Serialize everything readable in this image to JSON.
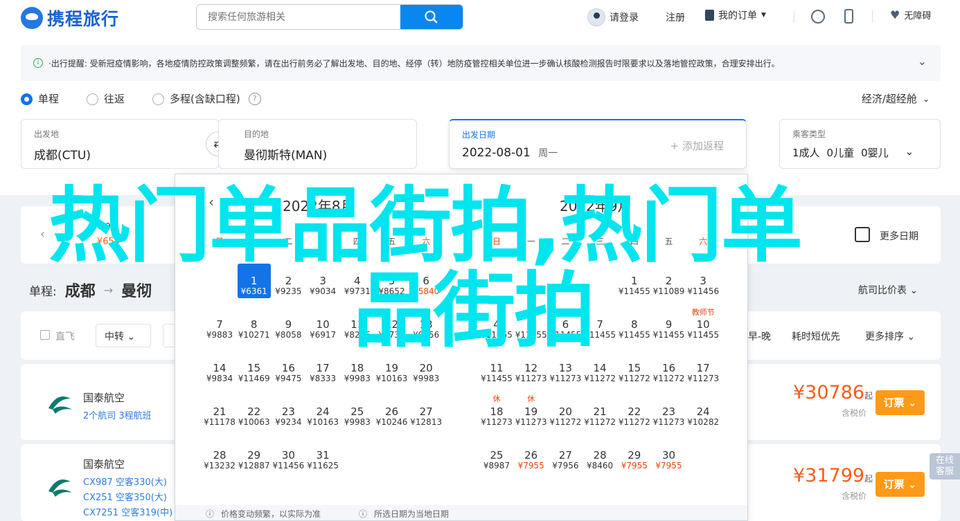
{
  "header": {
    "logo_text": "携程旅行",
    "search_placeholder": "搜索任何旅游相关",
    "login": "请登录",
    "register": "注册",
    "orders": "我的订单",
    "accessible": "无障碍"
  },
  "notice": {
    "text": "·出行提醒: 受新冠疫情影响，各地疫情防控政策调整频繁，请在出行前务必了解出发地、目的地、经停（转）地防疫管控相关单位进一步确认核酸检测报告时限要求以及落地管控政策，合理安排出行。"
  },
  "trip": {
    "oneway": "单程",
    "roundtrip": "往返",
    "multi": "多程(含缺口程)",
    "cabin": "经济/超经舱"
  },
  "form": {
    "from_label": "出发地",
    "from": "成都(CTU)",
    "to_label": "目的地",
    "to": "曼彻斯特(MAN)",
    "date_label": "出发日期",
    "date": "2022-08-01",
    "weekday": "周一",
    "add_return": "+ 添加返程",
    "pax_label": "乘客类型",
    "adult": "1成人",
    "child": "0儿童",
    "infant": "0婴儿"
  },
  "route": {
    "prefix": "单程:",
    "from": "成都",
    "to": "曼彻"
  },
  "strip": {
    "item_date": "7-9",
    "item_price": "¥654",
    "more_dates": "更多日期"
  },
  "sort": {
    "airline_compare": "航司比价表",
    "direct": "直飞",
    "transfer": "中转",
    "early_late": "早-晚",
    "shortest": "耗时短优先",
    "more_sort": "更多排序"
  },
  "flights": [
    {
      "airline": "国泰航空",
      "detail": "2个航司  3程航班",
      "price": "¥30786",
      "qi": "起",
      "tax": "含税价",
      "book": "订票"
    },
    {
      "airline": "国泰航空",
      "lines": [
        "CX987 空客330(大)",
        "CX251 空客350(大)",
        "CX7251 空客319(中)"
      ],
      "price": "¥31799",
      "qi": "起",
      "tax": "含税价",
      "book": "订票"
    }
  ],
  "calendar": {
    "left_title": "2022年8月",
    "right_title": "2022年9月",
    "left_days": [
      {
        "d": "1",
        "p": "¥6361",
        "c": 1,
        "r": 0,
        "sel": true
      },
      {
        "d": "2",
        "p": "¥9235",
        "c": 2,
        "r": 0
      },
      {
        "d": "3",
        "p": "¥9034",
        "c": 3,
        "r": 0
      },
      {
        "d": "4",
        "p": "¥9731",
        "c": 4,
        "r": 0
      },
      {
        "d": "5",
        "p": "¥8652",
        "c": 5,
        "r": 0
      },
      {
        "d": "6",
        "p": "¥5840",
        "c": 6,
        "r": 0,
        "red": true
      },
      {
        "d": "7",
        "p": "¥9883",
        "c": 0,
        "r": 1
      },
      {
        "d": "8",
        "p": "¥10271",
        "c": 1,
        "r": 1
      },
      {
        "d": "9",
        "p": "¥8058",
        "c": 2,
        "r": 1
      },
      {
        "d": "10",
        "p": "¥6917",
        "c": 3,
        "r": 1
      },
      {
        "d": "11",
        "p": "¥8216",
        "c": 4,
        "r": 1
      },
      {
        "d": "12",
        "p": "¥8733",
        "c": 5,
        "r": 1
      },
      {
        "d": "13",
        "p": "¥9656",
        "c": 6,
        "r": 1
      },
      {
        "d": "14",
        "p": "¥9834",
        "c": 0,
        "r": 2
      },
      {
        "d": "15",
        "p": "¥11469",
        "c": 1,
        "r": 2
      },
      {
        "d": "16",
        "p": "¥9475",
        "c": 2,
        "r": 2
      },
      {
        "d": "17",
        "p": "¥8333",
        "c": 3,
        "r": 2
      },
      {
        "d": "18",
        "p": "¥9983",
        "c": 4,
        "r": 2
      },
      {
        "d": "19",
        "p": "¥10163",
        "c": 5,
        "r": 2
      },
      {
        "d": "20",
        "p": "¥9983",
        "c": 6,
        "r": 2
      },
      {
        "d": "21",
        "p": "¥11178",
        "c": 0,
        "r": 3
      },
      {
        "d": "22",
        "p": "¥10063",
        "c": 1,
        "r": 3
      },
      {
        "d": "23",
        "p": "¥9234",
        "c": 2,
        "r": 3
      },
      {
        "d": "24",
        "p": "¥10163",
        "c": 3,
        "r": 3
      },
      {
        "d": "25",
        "p": "¥9983",
        "c": 4,
        "r": 3
      },
      {
        "d": "26",
        "p": "¥10246",
        "c": 5,
        "r": 3
      },
      {
        "d": "27",
        "p": "¥12813",
        "c": 6,
        "r": 3
      },
      {
        "d": "28",
        "p": "¥13232",
        "c": 0,
        "r": 4
      },
      {
        "d": "29",
        "p": "¥12887",
        "c": 1,
        "r": 4
      },
      {
        "d": "30",
        "p": "¥11456",
        "c": 2,
        "r": 4
      },
      {
        "d": "31",
        "p": "¥11625",
        "c": 3,
        "r": 4
      }
    ],
    "right_days": [
      {
        "d": "1",
        "p": "¥11455",
        "c": 4,
        "r": 0
      },
      {
        "d": "2",
        "p": "¥11089",
        "c": 5,
        "r": 0
      },
      {
        "d": "3",
        "p": "¥11456",
        "c": 6,
        "r": 0
      },
      {
        "d": "4",
        "p": "¥11455",
        "c": 0,
        "r": 1
      },
      {
        "d": "5",
        "p": "¥11455",
        "c": 1,
        "r": 1
      },
      {
        "d": "6",
        "p": "¥11455",
        "c": 2,
        "r": 1
      },
      {
        "d": "7",
        "p": "¥11455",
        "c": 3,
        "r": 1
      },
      {
        "d": "8",
        "p": "¥11455",
        "c": 4,
        "r": 1
      },
      {
        "d": "9",
        "p": "¥11455",
        "c": 5,
        "r": 1
      },
      {
        "d": "10",
        "p": "¥11455",
        "c": 6,
        "r": 1,
        "tag": "教师节"
      },
      {
        "d": "11",
        "p": "¥11455",
        "c": 0,
        "r": 2,
        "tag": "休"
      },
      {
        "d": "12",
        "p": "¥11273",
        "c": 1,
        "r": 2,
        "tag": "休"
      },
      {
        "d": "13",
        "p": "¥11273",
        "c": 2,
        "r": 2
      },
      {
        "d": "14",
        "p": "¥11272",
        "c": 3,
        "r": 2
      },
      {
        "d": "15",
        "p": "¥11272",
        "c": 4,
        "r": 2
      },
      {
        "d": "16",
        "p": "¥11272",
        "c": 5,
        "r": 2
      },
      {
        "d": "17",
        "p": "¥11273",
        "c": 6,
        "r": 2
      },
      {
        "d": "18",
        "p": "¥11273",
        "c": 0,
        "r": 3
      },
      {
        "d": "19",
        "p": "¥11273",
        "c": 1,
        "r": 3
      },
      {
        "d": "20",
        "p": "¥11272",
        "c": 2,
        "r": 3
      },
      {
        "d": "21",
        "p": "¥11272",
        "c": 3,
        "r": 3
      },
      {
        "d": "22",
        "p": "¥11272",
        "c": 4,
        "r": 3
      },
      {
        "d": "23",
        "p": "¥11273",
        "c": 5,
        "r": 3
      },
      {
        "d": "24",
        "p": "¥10282",
        "c": 6,
        "r": 3
      },
      {
        "d": "25",
        "p": "¥8987",
        "c": 0,
        "r": 4
      },
      {
        "d": "26",
        "p": "¥7955",
        "c": 1,
        "r": 4,
        "red": true
      },
      {
        "d": "27",
        "p": "¥7956",
        "c": 2,
        "r": 4
      },
      {
        "d": "28",
        "p": "¥8460",
        "c": 3,
        "r": 4
      },
      {
        "d": "29",
        "p": "¥7955",
        "c": 4,
        "r": 4,
        "red": true
      },
      {
        "d": "30",
        "p": "¥7955",
        "c": 5,
        "r": 4,
        "red": true
      }
    ],
    "left_weekdays": [
      "日",
      "一",
      "二",
      "三",
      "四",
      "五",
      "六"
    ],
    "right_weekdays": [
      "日",
      "一",
      "二",
      "三",
      "四",
      "五",
      "六"
    ],
    "foot_left": "价格变动频繁，以实际为准",
    "foot_right": "所选日期为当地日期"
  },
  "watermark": {
    "line1": "热门单品街拍,热门单",
    "line2": "品街拍"
  },
  "fab": {
    "line1": "在线",
    "line2": "客服"
  },
  "colors": {
    "brand": "#1473e6",
    "price": "#f55d1a",
    "book": "#ff9a18",
    "watermark": "#00e5ee"
  }
}
